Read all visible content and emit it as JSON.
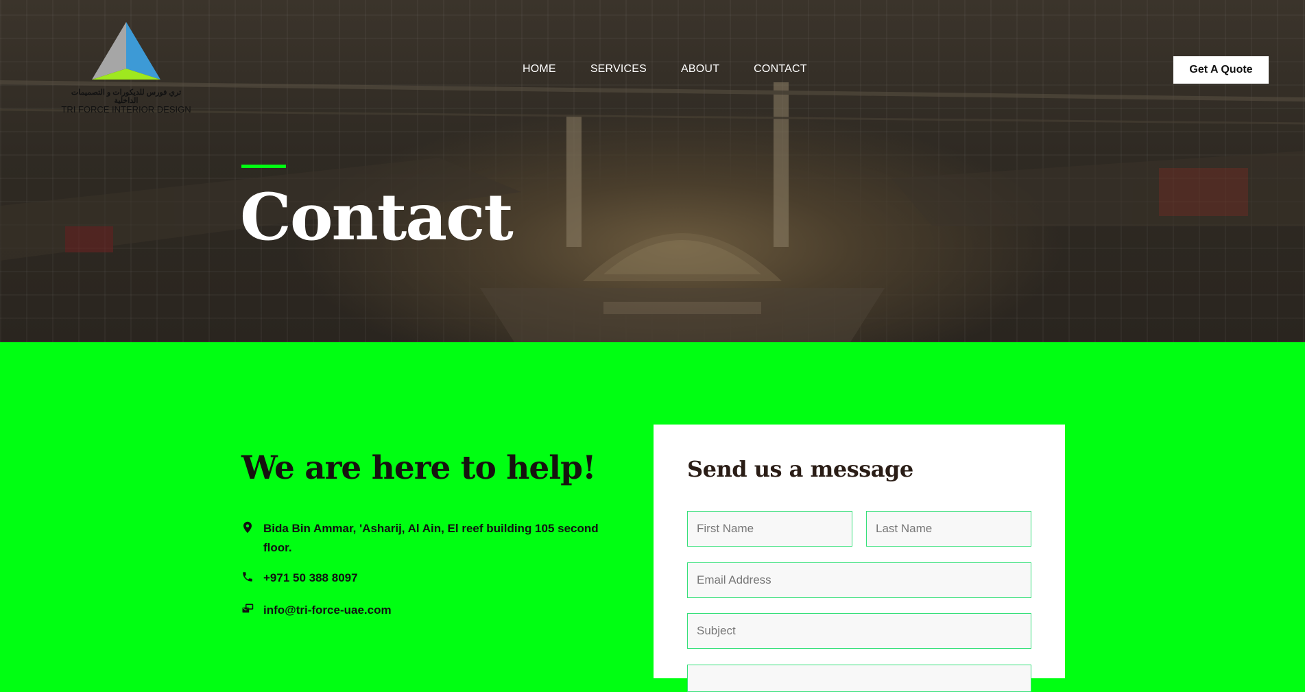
{
  "logo": {
    "arabic_text": "تري فورس للديكورات و التصميمات الداخلية",
    "name": "TRI FORCE INTERIOR DESIGN"
  },
  "nav": {
    "items": [
      {
        "label": "HOME"
      },
      {
        "label": "SERVICES"
      },
      {
        "label": "ABOUT"
      },
      {
        "label": "CONTACT"
      }
    ]
  },
  "header": {
    "cta_label": "Get A Quote"
  },
  "hero": {
    "title": "Contact"
  },
  "contact_info": {
    "heading": "We are here to help!",
    "address": "Bida Bin Ammar, 'Asharij, Al Ain, El reef building 105 second floor.",
    "phone": "+971 50 388 8097",
    "email": "info@tri-force-uae.com"
  },
  "form": {
    "title": "Send us a message",
    "first_name_placeholder": "First Name",
    "last_name_placeholder": "Last Name",
    "email_placeholder": "Email Address",
    "subject_placeholder": "Subject"
  },
  "colors": {
    "accent_green": "#00ff12",
    "field_border": "#36e07a",
    "logo_gray": "#a6a6a6",
    "logo_blue": "#3d9ad6",
    "logo_lime": "#9fe81f"
  },
  "icons": [
    "location-pin-icon",
    "phone-icon",
    "email-icon"
  ]
}
